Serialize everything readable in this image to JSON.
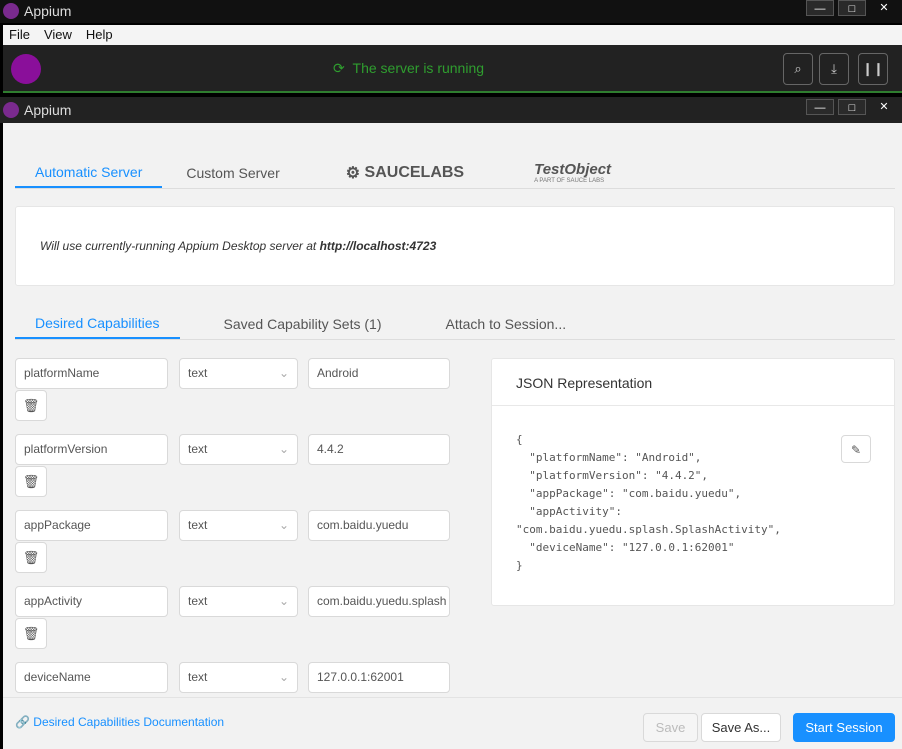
{
  "outer_window": {
    "title": "Appium",
    "controls": [
      "—",
      "□",
      "✕"
    ]
  },
  "menu": [
    "File",
    "View",
    "Help"
  ],
  "server_bar": {
    "status": "The server is running",
    "status_color": "#2f9e2f",
    "buttons": [
      "search-icon",
      "download-icon",
      "pause-icon"
    ]
  },
  "inner_window": {
    "title": "Appium",
    "controls": [
      "—",
      "□",
      "✕"
    ]
  },
  "server_tabs": [
    "Automatic Server",
    "Custom Server"
  ],
  "server_logos": {
    "saucelabs": "SAUCELABS",
    "testobject": "TestObject",
    "testobject_sub": "A PART OF SAUCE LABS"
  },
  "info": {
    "text": "Will use currently-running Appium Desktop server at ",
    "url": "http://localhost:4723"
  },
  "cap_tabs": [
    "Desired Capabilities",
    "Saved Capability Sets (1)",
    "Attach to Session..."
  ],
  "capabilities": [
    {
      "name": "platformName",
      "type": "text",
      "value": "Android"
    },
    {
      "name": "platformVersion",
      "type": "text",
      "value": "4.4.2"
    },
    {
      "name": "appPackage",
      "type": "text",
      "value": "com.baidu.yuedu"
    },
    {
      "name": "appActivity",
      "type": "text",
      "value": "com.baidu.yuedu.splash"
    },
    {
      "name": "deviceName",
      "type": "text",
      "value": "127.0.0.1:62001"
    }
  ],
  "json_panel": {
    "title": "JSON Representation",
    "body": "{\n  \"platformName\": \"Android\",\n  \"platformVersion\": \"4.4.2\",\n  \"appPackage\": \"com.baidu.yuedu\",\n  \"appActivity\":\n\"com.baidu.yuedu.splash.SplashActivity\",\n  \"deviceName\": \"127.0.0.1:62001\"\n}"
  },
  "footer": {
    "doc_link": "Desired Capabilities Documentation",
    "save": "Save",
    "save_as": "Save As...",
    "start": "Start Session",
    "accent": "#1890ff"
  }
}
